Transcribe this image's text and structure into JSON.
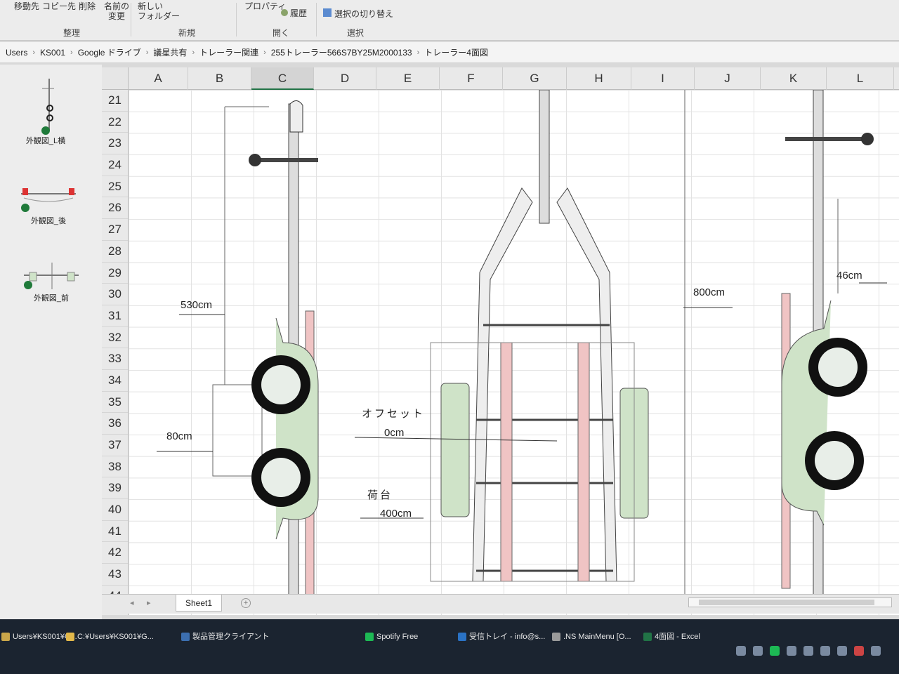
{
  "ribbon": {
    "buttons": {
      "move_to": "移動先",
      "copy_to": "コピー先",
      "delete": "削除",
      "rename": "名前の\n変更",
      "new_folder": "新しい\nフォルダー",
      "properties": "プロパティ",
      "history": "履歴",
      "invert_selection": "選択の切り替え"
    },
    "groups": {
      "organize": "整理",
      "new": "新規",
      "open": "開く",
      "select": "選択"
    }
  },
  "breadcrumb": [
    "Users",
    "KS001",
    "Google ドライブ",
    "議星共有",
    "トレーラー関連",
    "255トレーラー566S7BY25M2000133",
    "トレーラー4面図"
  ],
  "thumbnails": [
    {
      "label": "外観図_L横"
    },
    {
      "label": "外観図_後"
    },
    {
      "label": "外観図_前"
    }
  ],
  "columns": [
    "A",
    "B",
    "C",
    "D",
    "E",
    "F",
    "G",
    "H",
    "I",
    "J",
    "K",
    "L"
  ],
  "selected_column": "C",
  "rows": [
    "21",
    "22",
    "23",
    "24",
    "25",
    "26",
    "27",
    "28",
    "29",
    "30",
    "31",
    "32",
    "33",
    "34",
    "35",
    "36",
    "37",
    "38",
    "39",
    "40",
    "41",
    "42",
    "43",
    "44"
  ],
  "annotations": {
    "length_530": "530cm",
    "height_80": "80cm",
    "offset_label": "オフセット",
    "offset_value": "0cm",
    "deck_label": "荷台",
    "deck_value": "400cm",
    "length_800": "800cm",
    "width_46": "46cm"
  },
  "sheet_tab": "Sheet1",
  "taskbar": {
    "items": [
      "Users¥KS001¥G...",
      "C:¥Users¥KS001¥G...",
      "製品管理クライアント",
      "Spotify Free",
      "受信トレイ - info@s...",
      ".NS MainMenu [O...",
      "4面図 - Excel"
    ]
  },
  "colors": {
    "frame_green": "#cfe3c8",
    "frame_pink": "#f0c4c4",
    "tire": "#111111",
    "accent_excel": "#217346"
  }
}
